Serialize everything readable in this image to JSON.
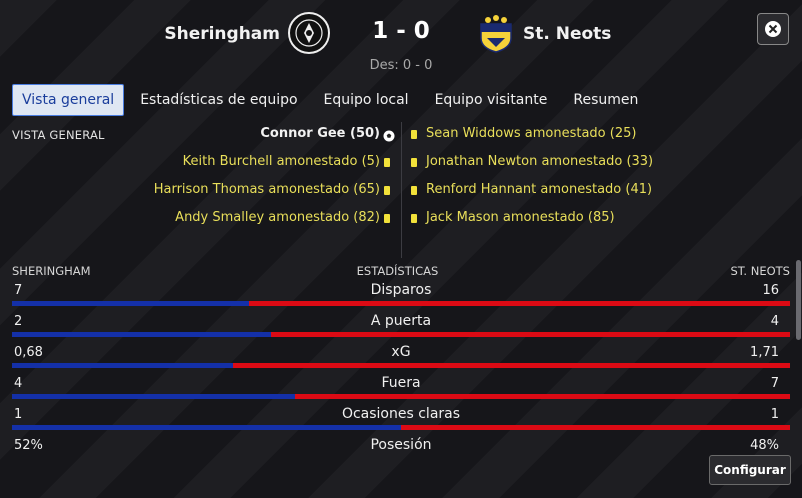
{
  "header": {
    "home_team": "Sheringham",
    "away_team": "St. Neots",
    "score": "1 - 0",
    "halftime": "Des: 0 - 0"
  },
  "tabs": [
    {
      "label": "Vista general",
      "active": true
    },
    {
      "label": "Estadísticas de equipo",
      "active": false
    },
    {
      "label": "Equipo local",
      "active": false
    },
    {
      "label": "Equipo visitante",
      "active": false
    },
    {
      "label": "Resumen",
      "active": false
    }
  ],
  "overview": {
    "section_label": "VISTA GENERAL",
    "home_events": [
      {
        "text": "Connor Gee (50)",
        "type": "goal"
      },
      {
        "text": "Keith Burchell amonestado (5)",
        "type": "yellow"
      },
      {
        "text": "Harrison Thomas amonestado (65)",
        "type": "yellow"
      },
      {
        "text": "Andy Smalley amonestado (82)",
        "type": "yellow"
      }
    ],
    "away_events": [
      {
        "text": "Sean Widdows amonestado (25)",
        "type": "yellow"
      },
      {
        "text": "Jonathan Newton amonestado (33)",
        "type": "yellow"
      },
      {
        "text": "Renford Hannant amonestado (41)",
        "type": "yellow"
      },
      {
        "text": "Jack Mason amonestado (85)",
        "type": "yellow"
      }
    ]
  },
  "stats": {
    "home_label": "SHERINGHAM",
    "title": "ESTADÍSTICAS",
    "away_label": "ST. NEOTS",
    "rows": [
      {
        "label": "Disparos",
        "home": "7",
        "away": "16",
        "home_share": 0.3043
      },
      {
        "label": "A puerta",
        "home": "2",
        "away": "4",
        "home_share": 0.3333
      },
      {
        "label": "xG",
        "home": "0,68",
        "away": "1,71",
        "home_share": 0.2845
      },
      {
        "label": "Fuera",
        "home": "4",
        "away": "7",
        "home_share": 0.3636
      },
      {
        "label": "Ocasiones claras",
        "home": "1",
        "away": "1",
        "home_share": 0.5
      },
      {
        "label": "Posesión",
        "home": "52%",
        "away": "48%",
        "home_share": 0.52
      }
    ]
  },
  "buttons": {
    "configure": "Configurar"
  },
  "colors": {
    "home_bar": "#1430a8",
    "away_bar": "#dc0a14",
    "yellow_card": "#f2e13a",
    "tab_active_bg": "#dfe7f3"
  },
  "icons": {
    "close": "close-icon",
    "goal": "football-icon",
    "card": "yellow-card-icon"
  }
}
